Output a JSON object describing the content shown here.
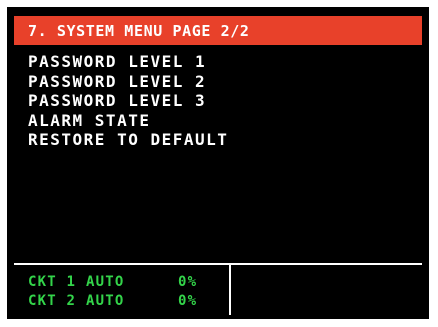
{
  "header": {
    "title": "7. SYSTEM MENU PAGE 2/2"
  },
  "menu": {
    "items": [
      {
        "label": "PASSWORD LEVEL 1"
      },
      {
        "label": "PASSWORD LEVEL 2"
      },
      {
        "label": "PASSWORD LEVEL 3"
      },
      {
        "label": "ALARM STATE"
      },
      {
        "label": "RESTORE TO DEFAULT"
      }
    ]
  },
  "status": {
    "circuits": [
      {
        "circuit": "CKT 1",
        "mode": "AUTO",
        "output": "0%"
      },
      {
        "circuit": "CKT 2",
        "mode": "AUTO",
        "output": "0%"
      }
    ]
  },
  "colors": {
    "title_bar": "#e8412a",
    "background": "#000000",
    "text": "#ffffff",
    "status_text": "#33d44a"
  }
}
